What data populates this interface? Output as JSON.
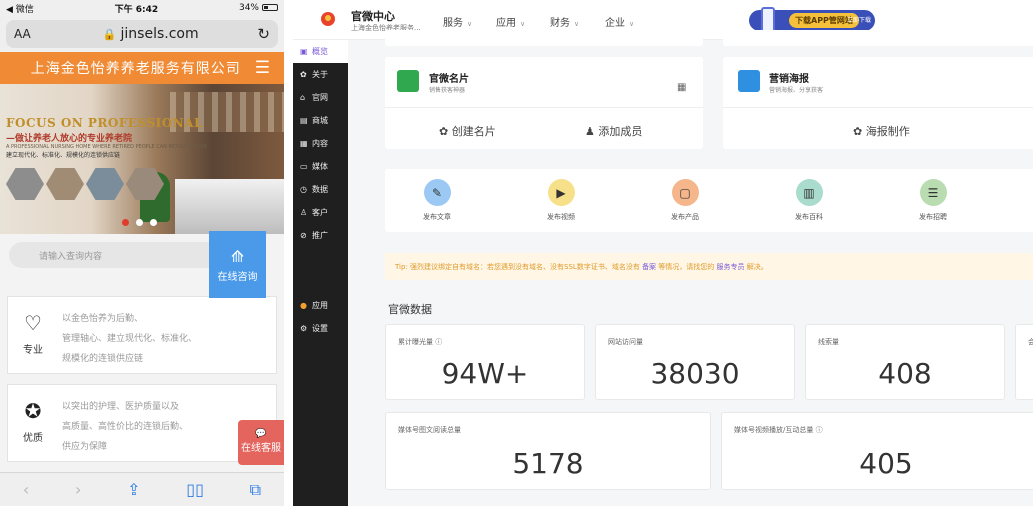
{
  "phone": {
    "status": {
      "carrier": "◀ 微信",
      "time": "下午 6:42",
      "battery": "34%"
    },
    "browser": {
      "aa": "AA",
      "url": "jinsels.com"
    },
    "header": {
      "company": "上海金色怡养养老服务有限公司",
      "menu_icon": "hamburger-icon"
    },
    "banner": {
      "title": "FOCUS ON PROFESSIONAL",
      "subtitle": "—做让养老人放心的专业养老院",
      "tiny": "A PROFESSIONAL NURSING HOME WHERE RETIRED PEOPLE CAN RETIRE TO LIVE",
      "tagline": "建立现代化、标准化、规模化的连锁供应链"
    },
    "search": {
      "placeholder": "请输入查询内容"
    },
    "consult": {
      "label": "在线咨询"
    },
    "cards": [
      {
        "title": "专业",
        "lines": [
          "以金色怡养为后勤、",
          "管理轴心、建立现代化、标准化、",
          "规模化的连锁供应链"
        ]
      },
      {
        "title": "优质",
        "lines": [
          "以突出的护理、医护质量以及",
          "高质量、高性价比的连锁后勤、",
          "供应为保障"
        ]
      }
    ],
    "float_service": {
      "label": "在线客服"
    }
  },
  "desktop": {
    "brand": {
      "title": "官微中心",
      "subtitle": "上海金色怡养老服务..."
    },
    "nav": [
      "服务",
      "应用",
      "财务",
      "企业"
    ],
    "promo": {
      "label": "下载APP管网站",
      "tag": "立即下载"
    },
    "sidebar": {
      "items": [
        {
          "icon": "▣",
          "label": "概览"
        },
        {
          "icon": "✿",
          "label": "关于"
        },
        {
          "icon": "⌂",
          "label": "官网"
        },
        {
          "icon": "▤",
          "label": "商城"
        },
        {
          "icon": "▦",
          "label": "内容"
        },
        {
          "icon": "▭",
          "label": "媒体"
        },
        {
          "icon": "◷",
          "label": "数据"
        },
        {
          "icon": "♙",
          "label": "客户"
        },
        {
          "icon": "⊘",
          "label": "推广"
        }
      ],
      "bottom": [
        {
          "icon": "●",
          "label": "应用"
        },
        {
          "icon": "⚙",
          "label": "设置"
        }
      ]
    },
    "tools": [
      {
        "title": "官微名片",
        "subtitle": "销售获客神器",
        "actions": [
          "✿ 创建名片",
          "♟ 添加成员"
        ],
        "color": "#2fa84f"
      },
      {
        "title": "营销海报",
        "subtitle": "营销海报、分享获客",
        "actions": [
          "✿ 海报制作"
        ],
        "color": "#2f8fe0"
      }
    ],
    "quick": [
      {
        "label": "发布文章",
        "color": "#9cc9f3",
        "icon": "✎"
      },
      {
        "label": "发布视频",
        "color": "#f7e08a",
        "icon": "▶"
      },
      {
        "label": "发布产品",
        "color": "#f5b68c",
        "icon": "▢"
      },
      {
        "label": "发布百科",
        "color": "#a9dccd",
        "icon": "▥"
      },
      {
        "label": "发布招聘",
        "color": "#b9dcb0",
        "icon": "☰"
      }
    ],
    "tip": {
      "prefix": "Tip: 强烈建议绑定自有域名：若您遇到没有域名、没有SSL数字证书、域名没有",
      "link1": "备案",
      "middle": "等情况，请找您的",
      "link2": "服务专员",
      "suffix": "解决。"
    },
    "section_title": "官微数据",
    "stats": [
      {
        "label": "累计曝光量 ⓘ",
        "value": "94W+"
      },
      {
        "label": "网站访问量",
        "value": "38030"
      },
      {
        "label": "线索量",
        "value": "408"
      },
      {
        "label": "会",
        "value": ""
      },
      {
        "label": "媒体号图文阅读总量",
        "value": "5178"
      },
      {
        "label": "媒体号视频播放/互动总量 ⓘ",
        "value": "405"
      }
    ]
  }
}
